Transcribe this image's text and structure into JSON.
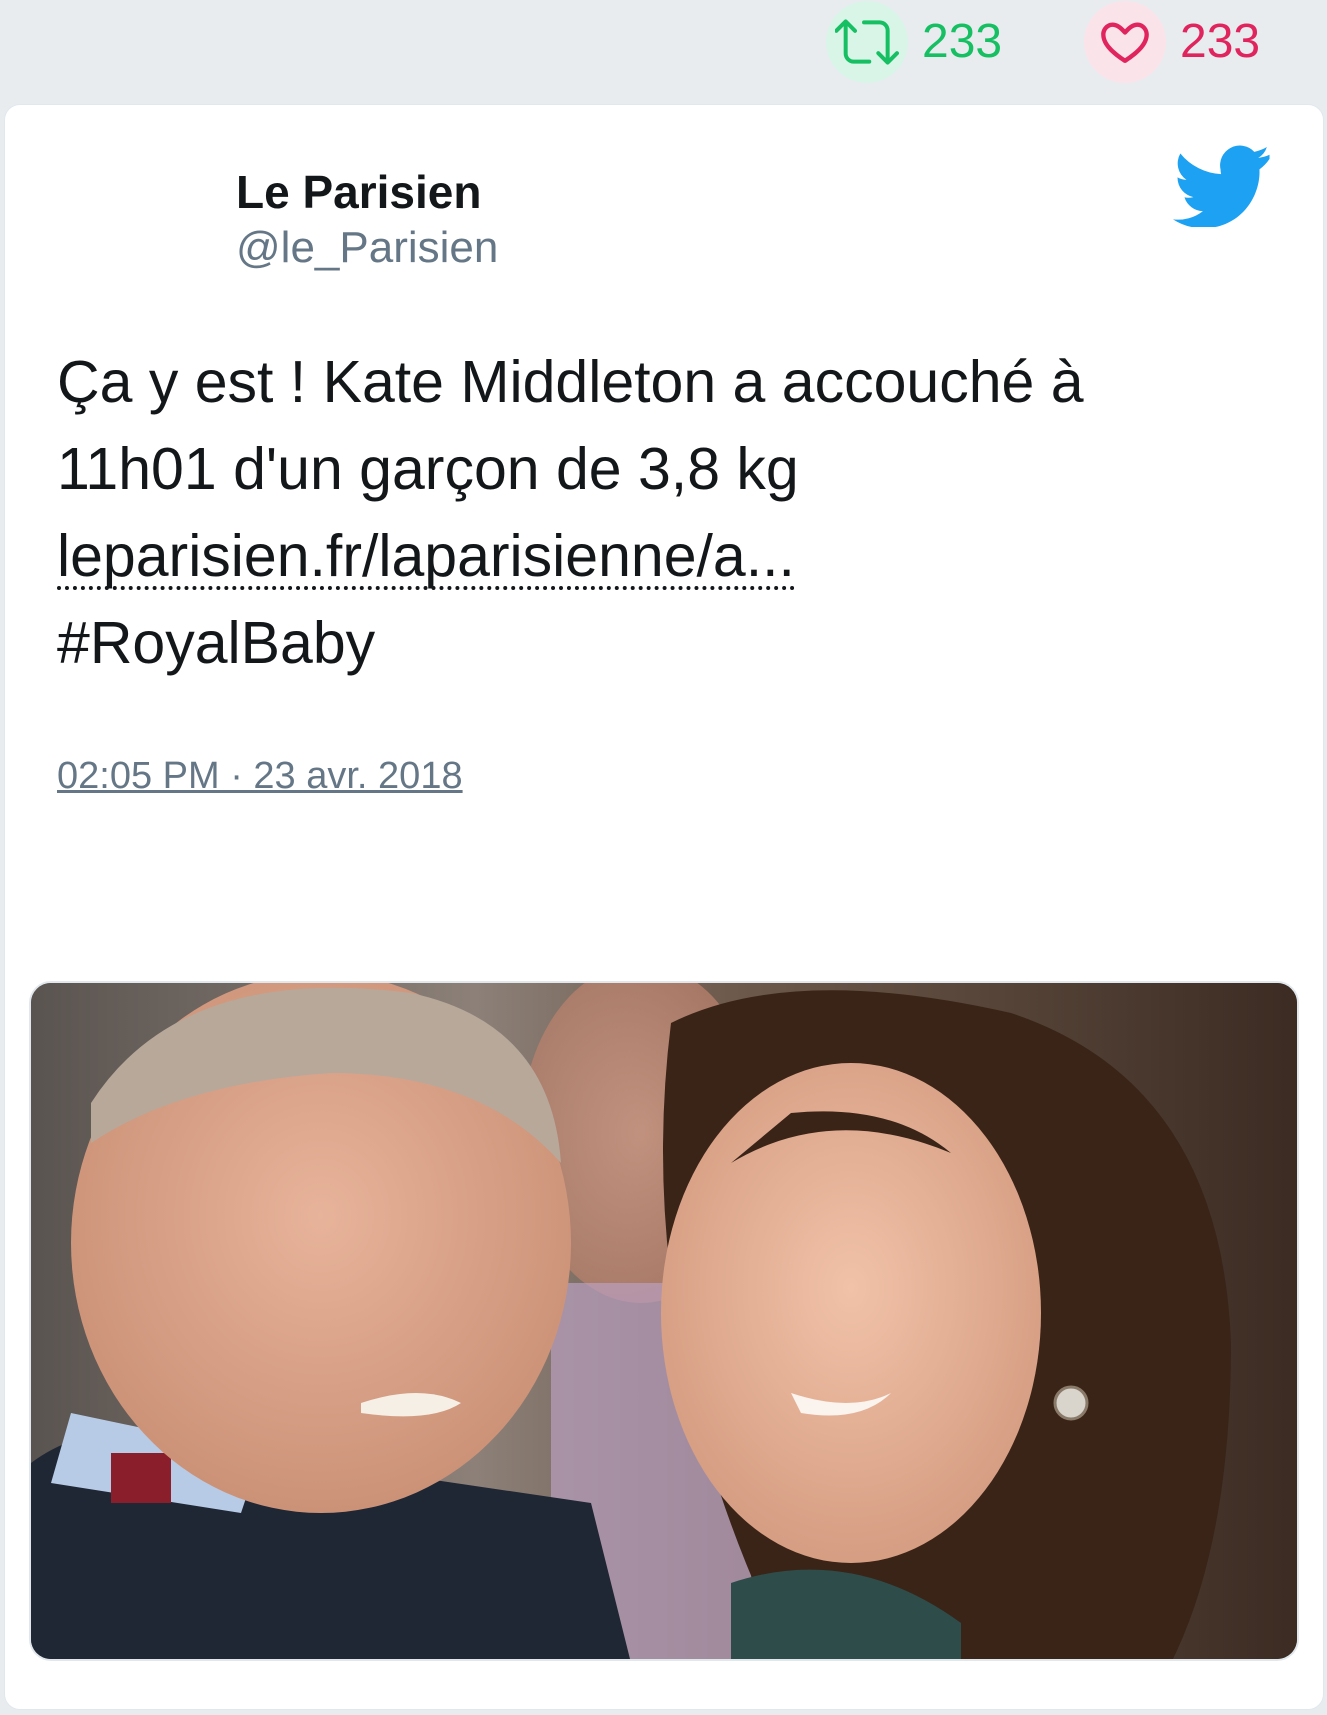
{
  "top_stats": {
    "retweets": "233",
    "likes": "233"
  },
  "tweet": {
    "author_name": "Le Parisien",
    "author_handle": "@le_Parisien",
    "text_line1": "Ça y est ! Kate Middleton a accouché à",
    "text_line2": "11h01 d'un garçon de 3,8 kg",
    "link": "leparisien.fr/laparisienne/a...",
    "hashtag": "#RoyalBaby",
    "timestamp": "02:05 PM · 23 avr. 2018"
  },
  "colors": {
    "retweet_green": "#17bf63",
    "like_red": "#e0245e",
    "twitter_blue": "#1da1f2",
    "secondary_text": "#657786"
  },
  "icons": [
    "retweet-icon",
    "heart-icon",
    "twitter-bird-icon",
    "reply-icon"
  ],
  "media": {
    "type": "photo"
  }
}
